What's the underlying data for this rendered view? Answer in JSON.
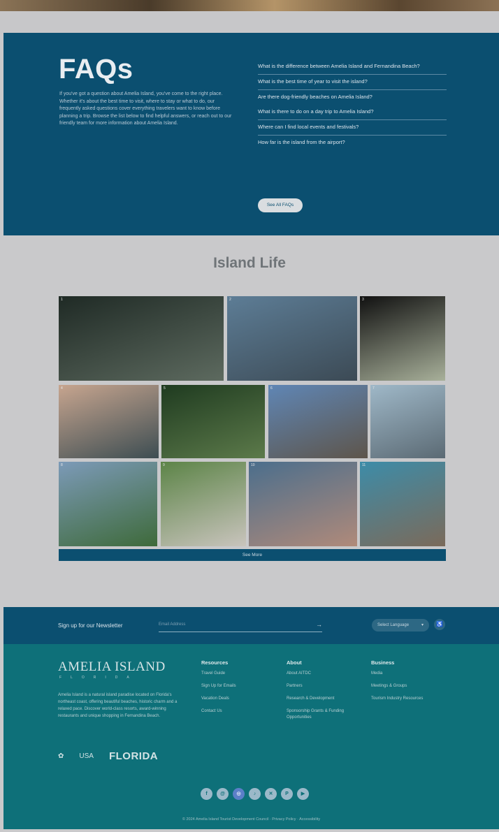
{
  "faq": {
    "title": "FAQs",
    "intro": "If you've got a question about Amelia Island, you've come to the right place. Whether it's about the best time to visit, where to stay or what to do, our frequently asked questions cover everything travelers want to know before planning a trip. Browse the list below to find helpful answers, or reach out to our friendly team for more information about Amelia Island.",
    "questions": [
      "What is the difference between Amelia Island and Fernandina Beach?",
      "What is the best time of year to visit the island?",
      "Are there dog-friendly beaches on Amelia Island?",
      "What is there to do on a day trip to Amelia Island?",
      "Where can I find local events and festivals?",
      "How far is the island from the airport?"
    ],
    "button_label": "See All FAQs"
  },
  "island": {
    "title": "Island Life",
    "see_more_label": "See More",
    "tiles": [
      {
        "idx": "1",
        "subject": "alligator in swamp",
        "colors": [
          "#1f2a25",
          "#5d6a5f"
        ]
      },
      {
        "idx": "2",
        "subject": "woman on beach",
        "colors": [
          "#5d7d96",
          "#3c4a55"
        ]
      },
      {
        "idx": "3",
        "subject": "plated dish",
        "colors": [
          "#111111",
          "#a8b09a"
        ]
      },
      {
        "idx": "4",
        "subject": "coastal sunset aerial",
        "colors": [
          "#c7a58f",
          "#3d4d52"
        ]
      },
      {
        "idx": "5",
        "subject": "oak tree road",
        "colors": [
          "#1f3b20",
          "#5c7a4a"
        ]
      },
      {
        "idx": "6",
        "subject": "golf carts on dock",
        "colors": [
          "#5f86b5",
          "#5e554b"
        ]
      },
      {
        "idx": "7",
        "subject": "family portrait",
        "colors": [
          "#9fb8c8",
          "#5b6a74"
        ]
      },
      {
        "idx": "8",
        "subject": "marsh golf course",
        "colors": [
          "#7c9ab8",
          "#3e6a3a"
        ]
      },
      {
        "idx": "9",
        "subject": "group on segways",
        "colors": [
          "#5c8447",
          "#c9c4bd"
        ]
      },
      {
        "idx": "10",
        "subject": "fishermen with catch",
        "colors": [
          "#4b6e8c",
          "#b08a7a"
        ]
      },
      {
        "idx": "11",
        "subject": "pier at beach",
        "colors": [
          "#3d8ca8",
          "#7b6a5a"
        ]
      }
    ]
  },
  "newsletter": {
    "label": "Sign up for our Newsletter",
    "placeholder": "Email Address",
    "submit": "→",
    "language": "Select Language",
    "language_arrow": "▾",
    "access_icon": "accessibility-icon",
    "access_glyph": "♿"
  },
  "footer": {
    "logo": "AMELIA ISLAND",
    "logo_sub": "FLORIDA",
    "description": "Amelia Island is a natural island paradise located on Florida's northeast coast, offering beautiful beaches, historic charm and a relaxed pace. Discover world-class resorts, award-winning restaurants and unique shopping in Fernandina Beach.",
    "partners": [
      "✿",
      "USA",
      "FLORIDA"
    ],
    "columns": [
      {
        "heading": "Resources",
        "links": [
          "Travel Guide",
          "Sign Up for Emails",
          "Vacation Deals",
          "Contact Us"
        ]
      },
      {
        "heading": "About",
        "links": [
          "About AITDC",
          "Partners",
          "Research & Development",
          "Sponsorship Grants & Funding Opportunities"
        ]
      },
      {
        "heading": "Business",
        "links": [
          "Media",
          "Meetings & Groups",
          "Tourism Industry Resources"
        ]
      }
    ],
    "socials": [
      "f",
      "@",
      "◎",
      "♪",
      "✕",
      "P",
      "▶"
    ],
    "social_icons": [
      "facebook-icon",
      "instagram-icon",
      "threads-icon",
      "tiktok-icon",
      "x-icon",
      "pinterest-icon",
      "youtube-icon"
    ],
    "copyright": "© 2024 Amelia Island Tourist Development Council · Privacy Policy · Accessibility"
  }
}
